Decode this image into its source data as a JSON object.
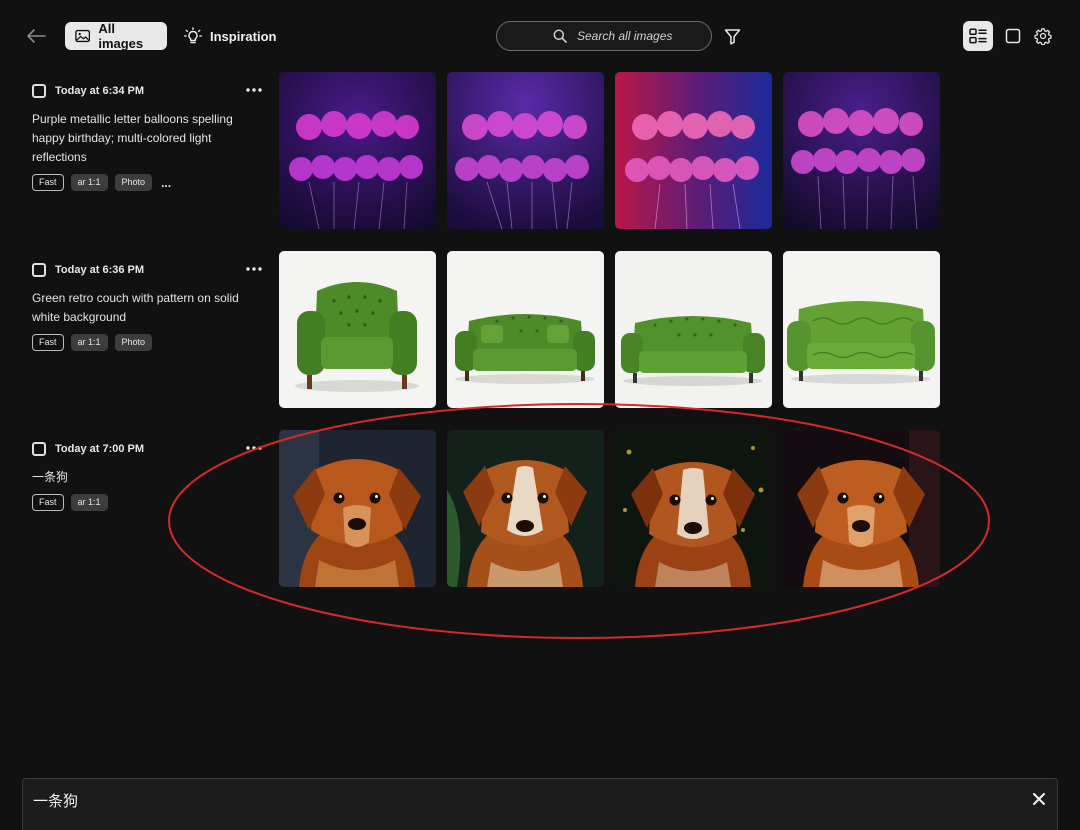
{
  "topbar": {
    "all_images_label": "All images",
    "inspiration_label": "Inspiration",
    "search_placeholder": "Search all images"
  },
  "generations": [
    {
      "timestamp": "Today at 6:34 PM",
      "prompt": "Purple metallic letter balloons spelling happy birthday; multi-colored light reflections",
      "tags": [
        "Fast",
        "ar 1:1",
        "Photo"
      ],
      "more_tags": "...",
      "image_count": 4,
      "subject": "birthday-balloons"
    },
    {
      "timestamp": "Today at 6:36 PM",
      "prompt": "Green retro couch with pattern on solid white background",
      "tags": [
        "Fast",
        "ar 1:1",
        "Photo"
      ],
      "image_count": 4,
      "subject": "green-couch"
    },
    {
      "timestamp": "Today at 7:00 PM",
      "prompt": "一条狗",
      "tags": [
        "Fast",
        "ar 1:1"
      ],
      "image_count": 4,
      "subject": "dog-portrait",
      "annotated": true
    }
  ],
  "prompt_bar": {
    "text": "一条狗"
  },
  "colors": {
    "background": "#111111",
    "annotation": "#d42a2a",
    "balloon_pink": "#e23fd0",
    "couch_green": "#4f8f2a",
    "dog_fur": "#b4571d"
  },
  "icons": {
    "back": "arrow-left-icon",
    "all_images": "image-icon",
    "inspiration": "lightbulb-icon",
    "search": "search-icon",
    "filter": "funnel-icon",
    "grid_view": "grid-list-icon",
    "single_view": "square-icon",
    "settings": "gear-icon",
    "more": "ellipsis-icon",
    "close": "close-icon"
  }
}
